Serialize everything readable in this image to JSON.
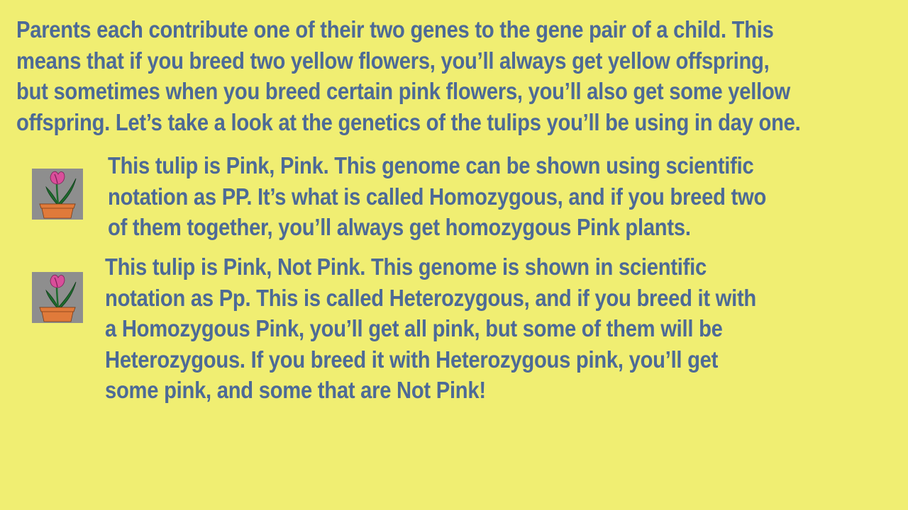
{
  "colors": {
    "background": "#F0EE72",
    "text": "#4D6A96",
    "icon_background": "#8E8E8E",
    "petal": "#D94E9A",
    "stem": "#1E6B2E",
    "pot": "#E07A3A"
  },
  "intro": {
    "lines": [
      "Parents each contribute one of their two genes to the gene pair of a child. This",
      "means that if you breed two yellow flowers, you’ll always get yellow offspring,",
      "but sometimes when you breed certain pink flowers, you’ll also get some yellow",
      "offspring. Let’s take a look at the genetics of the tulips you’ll be using in day one."
    ]
  },
  "homozygous": {
    "icon": "tulip-icon",
    "lines": [
      "This tulip is Pink, Pink. This genome can be shown using scientific",
      "notation as PP. It’s what is called Homozygous, and if you breed two",
      "of them together, you’ll always get homozygous Pink plants."
    ]
  },
  "heterozygous": {
    "icon": "tulip-icon",
    "lines": [
      "This tulip is Pink, Not Pink. This genome is shown in scientific",
      "notation as Pp. This is called Heterozygous, and if you breed it with",
      "a Homozygous Pink, you’ll get all pink, but some of them will be",
      "Heterozygous. If you breed it with Heterozygous pink, you’ll get",
      "some pink, and some that are Not Pink!"
    ]
  }
}
